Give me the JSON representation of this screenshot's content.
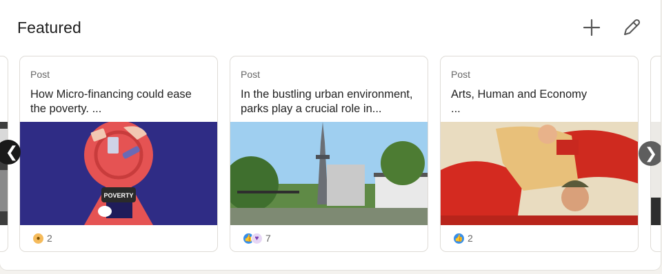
{
  "section": {
    "title": "Featured",
    "add_icon": "plus-icon",
    "edit_icon": "pencil-icon"
  },
  "carousel": {
    "prev_icon": "chevron-left-icon",
    "next_icon": "chevron-right-icon",
    "cards": [
      {
        "kind": "Post",
        "text": "How Micro-financing could ease the poverty. ...",
        "image_text": "POVERTY",
        "reactions": [
          "insightful-icon"
        ],
        "count": "2"
      },
      {
        "kind": "Post",
        "text": "In the bustling urban environment, parks play a crucial role in...",
        "reactions": [
          "like-icon",
          "support-icon"
        ],
        "count": "7"
      },
      {
        "kind": "Post",
        "text": "Arts, Human and Economy\n...",
        "reactions": [
          "like-icon"
        ],
        "count": "2"
      }
    ]
  },
  "colors": {
    "like": "#378fe9",
    "insightful": "#f5bb5c",
    "nav_dark": "#191919",
    "nav_grey": "#5e5e5e"
  }
}
